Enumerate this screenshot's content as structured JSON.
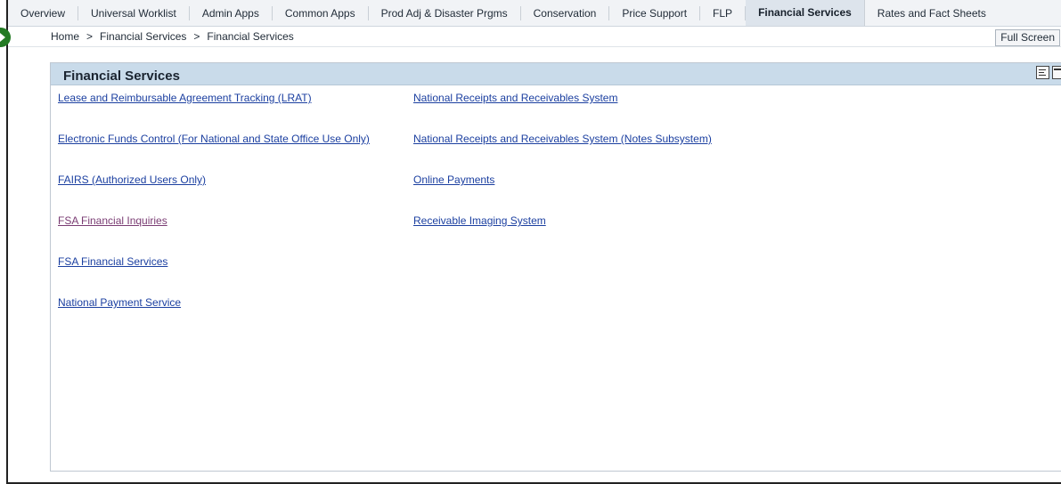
{
  "tabs": [
    {
      "label": "Overview"
    },
    {
      "label": "Universal Worklist"
    },
    {
      "label": "Admin Apps"
    },
    {
      "label": "Common Apps"
    },
    {
      "label": "Prod Adj & Disaster Prgms"
    },
    {
      "label": "Conservation"
    },
    {
      "label": "Price Support"
    },
    {
      "label": "FLP"
    },
    {
      "label": "Financial Services"
    },
    {
      "label": "Rates and Fact Sheets"
    }
  ],
  "breadcrumb": {
    "items": [
      "Home",
      "Financial Services",
      "Financial Services"
    ],
    "separator": ">"
  },
  "toolbar": {
    "full_screen_label": "Full Screen"
  },
  "portlet": {
    "title": "Financial Services",
    "left_links": [
      {
        "label": "Lease and Reimbursable Agreement Tracking (LRAT)"
      },
      {
        "label": "Electronic Funds Control (For National and State Office Use Only)"
      },
      {
        "label": "FAIRS (Authorized Users Only)"
      },
      {
        "label": "FSA Financial Inquiries"
      },
      {
        "label": "FSA Financial Services"
      },
      {
        "label": "National Payment Service"
      }
    ],
    "right_links": [
      {
        "label": "National Receipts and Receivables System"
      },
      {
        "label": "National Receipts and Receivables System (Notes Subsystem)"
      },
      {
        "label": "Online Payments"
      },
      {
        "label": "Receivable Imaging System"
      }
    ]
  },
  "colors": {
    "link": "#1b3fa0",
    "visited_link": "#7a3c73",
    "header_bg": "#c9dbea",
    "toggle_green": "#237a23"
  }
}
